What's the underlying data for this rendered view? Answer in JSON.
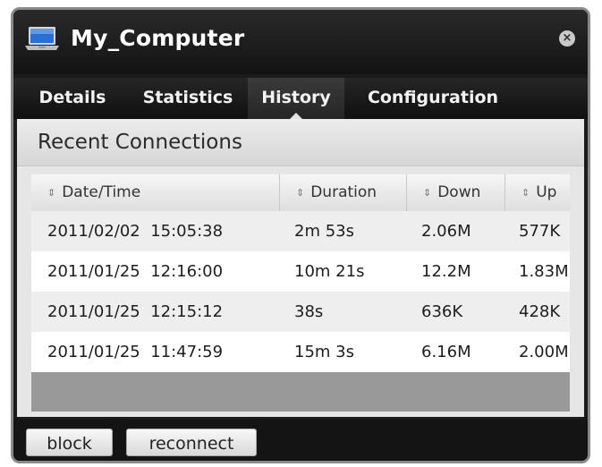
{
  "window": {
    "title": "My_Computer",
    "close_symbol": "×"
  },
  "tabs": [
    {
      "label": "Details",
      "active": false
    },
    {
      "label": "Statistics",
      "active": false
    },
    {
      "label": "History",
      "active": true
    },
    {
      "label": "Configuration",
      "active": false
    }
  ],
  "section": {
    "title": "Recent Connections"
  },
  "table": {
    "sort_glyph": "⇕",
    "columns": [
      "Date/Time",
      "Duration",
      "Down",
      "Up"
    ],
    "rows": [
      {
        "datetime": "2011/02/02  15:05:38",
        "duration": "2m 53s",
        "down": "2.06M",
        "up": "577K"
      },
      {
        "datetime": "2011/01/25  12:16:00",
        "duration": "10m 21s",
        "down": "12.2M",
        "up": "1.83M"
      },
      {
        "datetime": "2011/01/25  12:15:12",
        "duration": "38s",
        "down": "636K",
        "up": "428K"
      },
      {
        "datetime": "2011/01/25  11:47:59",
        "duration": "15m 3s",
        "down": "6.16M",
        "up": "2.00M"
      }
    ]
  },
  "footer": {
    "block_label": "block",
    "reconnect_label": "reconnect"
  },
  "colors": {
    "window_bg": "#1b1b1b",
    "panel_bg": "#e6e6e6",
    "table_empty_bg": "#999999"
  },
  "icons": {
    "window_icon": "laptop-icon",
    "close_icon": "close-icon",
    "sort_icon": "sort-arrows-icon"
  }
}
